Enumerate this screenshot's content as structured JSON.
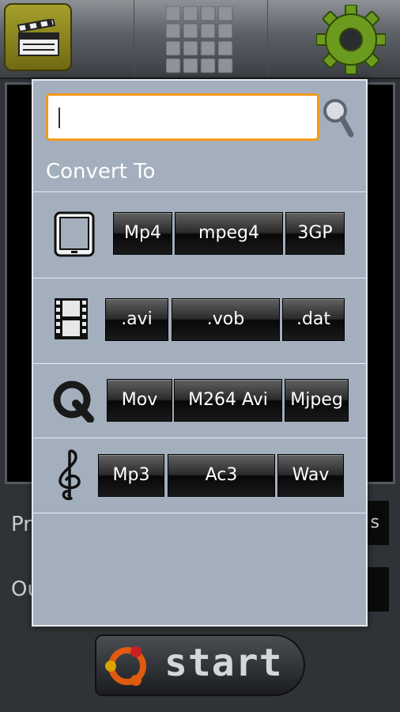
{
  "background": {
    "row1_label": "Pr",
    "row1_button": "s",
    "row2_label": "Ou",
    "start_label": "start"
  },
  "toolbar": {
    "buttons": [
      "video-clapper-icon",
      "grid-icon",
      "gear-icon"
    ]
  },
  "dialog": {
    "search_value": "",
    "title": "Convert To",
    "rows": [
      {
        "icon": "tablet-icon",
        "formats": [
          "Mp4",
          "mpeg4",
          "3GP"
        ]
      },
      {
        "icon": "film-strip-icon",
        "formats": [
          ".avi",
          ".vob",
          ".dat"
        ]
      },
      {
        "icon": "quicktime-icon",
        "formats": [
          "Mov",
          "M264 Avi",
          "Mjpeg"
        ]
      },
      {
        "icon": "music-clef-icon",
        "formats": [
          "Mp3",
          "Ac3",
          "Wav"
        ]
      }
    ]
  },
  "colors": {
    "accent": "#f39a1c",
    "dialog_bg": "#a3afbd",
    "clapper_button": "#a6a02c",
    "gear": "#6b9a1e"
  }
}
